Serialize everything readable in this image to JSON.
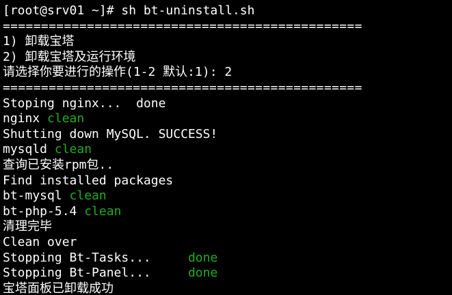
{
  "terminal": {
    "lines": [
      {
        "segments": [
          {
            "text": "[root@srv01 ~]# sh bt-uninstall.sh",
            "color": "white"
          }
        ]
      },
      {
        "segments": [
          {
            "text": "===============================================",
            "color": "white"
          }
        ],
        "kind": "separator"
      },
      {
        "segments": [
          {
            "text": "1) 卸载宝塔",
            "color": "white"
          }
        ]
      },
      {
        "segments": [
          {
            "text": "2) 卸载宝塔及运行环境",
            "color": "white"
          }
        ]
      },
      {
        "segments": [
          {
            "text": "请选择你要进行的操作(1-2 默认:1): 2",
            "color": "white"
          }
        ]
      },
      {
        "segments": [
          {
            "text": "===============================================",
            "color": "white"
          }
        ],
        "kind": "separator"
      },
      {
        "segments": [
          {
            "text": "Stoping nginx...  done",
            "color": "white"
          }
        ]
      },
      {
        "segments": [
          {
            "text": "nginx ",
            "color": "white"
          },
          {
            "text": "clean",
            "color": "green"
          }
        ]
      },
      {
        "segments": [
          {
            "text": "Shutting down MySQL. SUCCESS!",
            "color": "white"
          }
        ]
      },
      {
        "segments": [
          {
            "text": "mysqld ",
            "color": "white"
          },
          {
            "text": "clean",
            "color": "green"
          }
        ]
      },
      {
        "segments": [
          {
            "text": "查询已安装rpm包..",
            "color": "white"
          }
        ]
      },
      {
        "segments": [
          {
            "text": "Find installed packages",
            "color": "white"
          }
        ]
      },
      {
        "segments": [
          {
            "text": "bt-mysql ",
            "color": "white"
          },
          {
            "text": "clean",
            "color": "green"
          }
        ]
      },
      {
        "segments": [
          {
            "text": "bt-php-5.4 ",
            "color": "white"
          },
          {
            "text": "clean",
            "color": "green"
          }
        ]
      },
      {
        "segments": [
          {
            "text": "清理完毕",
            "color": "white"
          }
        ]
      },
      {
        "segments": [
          {
            "text": "Clean over",
            "color": "white"
          }
        ]
      },
      {
        "segments": [
          {
            "text": "Stopping Bt-Tasks...     ",
            "color": "white"
          },
          {
            "text": "done",
            "color": "green"
          }
        ]
      },
      {
        "segments": [
          {
            "text": "Stopping Bt-Panel...     ",
            "color": "white"
          },
          {
            "text": "done",
            "color": "green"
          }
        ]
      },
      {
        "segments": [
          {
            "text": "宝塔面板已卸载成功",
            "color": "white"
          }
        ]
      }
    ]
  },
  "colors": {
    "background": "#000000",
    "foreground": "#ffffff",
    "success": "#1fae1f"
  }
}
